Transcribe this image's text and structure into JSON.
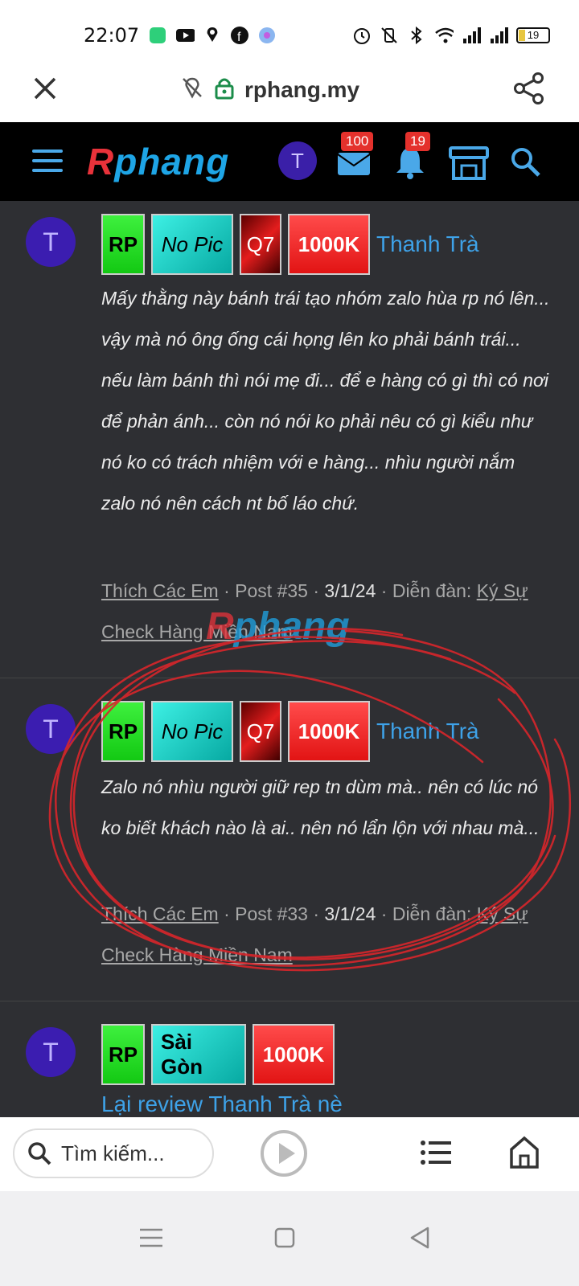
{
  "status_bar": {
    "time": "22:07",
    "battery": "19",
    "left_icons": [
      "app-icon",
      "youtube-icon",
      "location-icon",
      "facebook-icon",
      "chat-icon"
    ],
    "right_icons": [
      "alarm-icon",
      "vibrate-icon",
      "bluetooth-icon",
      "wifi-icon",
      "signal-icon",
      "signal-icon",
      "battery-icon"
    ]
  },
  "url_bar": {
    "url": "rphang.my"
  },
  "site_header": {
    "logo_first": "R",
    "logo_rest": "phang",
    "user_initial": "T",
    "messages_badge": "100",
    "notifications_badge": "19"
  },
  "posts": [
    {
      "avatar": "T",
      "tags": [
        "RP",
        "No Pic",
        "Q7",
        "1000K"
      ],
      "title": "Thanh Trà",
      "body": "Mấy thằng này bánh trái tạo nhóm zalo hùa rp nó lên... vậy mà nó ông ống cái họng lên ko phải bánh trái... nếu làm bánh thì nói mẹ đi... để e hàng có gì thì có nơi để phản ánh... còn nó nói ko phải nêu có gì kiểu như nó ko có trách nhiệm với e hàng... nhìu người nắm zalo nó nên cách nt bố láo chứ.",
      "author": "Thích Các Em",
      "post_no": "Post #35",
      "date": "3/1/24",
      "forum_label": "Diễn đàn:",
      "forum": "Ký Sự Check Hàng Miền Nam"
    },
    {
      "avatar": "T",
      "tags": [
        "RP",
        "No Pic",
        "Q7",
        "1000K"
      ],
      "title": "Thanh Trà",
      "body": "Zalo nó nhìu người giữ rep tn dùm mà.. nên có lúc nó ko biết khách nào là ai.. nên nó lẩn lộn với nhau mà...",
      "author": "Thích Các Em",
      "post_no": "Post #33",
      "date": "3/1/24",
      "forum_label": "Diễn đàn:",
      "forum": "Ký Sự Check Hàng Miền Nam"
    },
    {
      "avatar": "T",
      "tags": [
        "RP",
        "Sài Gòn",
        "1000K"
      ],
      "title": "Lại review Thanh Trà nè"
    }
  ],
  "watermark": {
    "first": "R",
    "rest": "phang"
  },
  "bottom_bar": {
    "search_placeholder": "Tìm kiếm..."
  },
  "colors": {
    "accent": "#3ea2e8",
    "header_bg": "#000000",
    "content_bg": "#2e2f33",
    "badge": "#e4312c",
    "annotation_red": "#d8262b"
  }
}
